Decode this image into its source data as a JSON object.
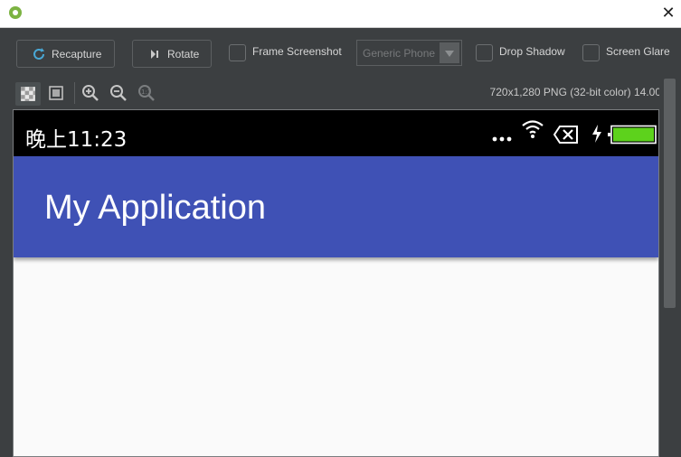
{
  "window": {
    "close_glyph": "✕"
  },
  "toolbar": {
    "recapture_label": "Recapture",
    "rotate_label": "Rotate",
    "frame_screenshot_label": "Frame Screenshot",
    "device_select_value": "Generic Phone",
    "drop_shadow_label": "Drop Shadow",
    "screen_glare_label": "Screen Glare"
  },
  "viewbar": {
    "image_info": "720x1,280 PNG (32-bit color) 14.00"
  },
  "device": {
    "status_time": "晚上11:23",
    "app_title": "My Application",
    "statusbar_color": "#000000",
    "appbar_color": "#3f51b5",
    "battery_color": "#5dd21c"
  },
  "icons": [
    "app-icon",
    "refresh-icon",
    "rotate-icon",
    "checkered-icon",
    "fit-screen-icon",
    "zoom-in-icon",
    "zoom-out-icon",
    "zoom-actual-icon",
    "more-dots-icon",
    "wifi-icon",
    "no-sim-icon",
    "charging-bolt-icon",
    "battery-icon"
  ]
}
